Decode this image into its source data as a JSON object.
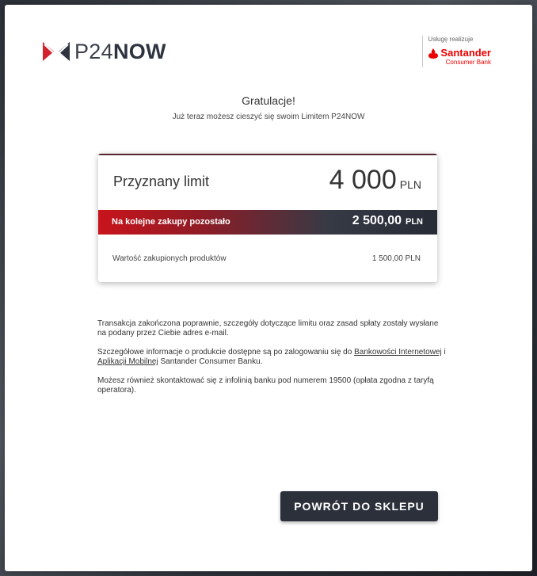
{
  "brand": {
    "logo_light": "P24",
    "logo_bold": "NOW",
    "partner_caption": "Usługę realizuje",
    "partner_name": "Santander",
    "partner_sub": "Consumer Bank"
  },
  "header": {
    "title": "Gratulacje!",
    "subtitle": "Już teraz możesz cieszyć się swoim Limitem P24NOW"
  },
  "limit_card": {
    "granted_label": "Przyznany limit",
    "granted_amount": "4 000",
    "granted_currency": "PLN",
    "remaining_label": "Na kolejne zakupy pozostało",
    "remaining_amount": "2 500,00",
    "remaining_currency": "PLN",
    "purchased_label": "Wartość zakupionych produktów",
    "purchased_amount": "1 500,00 PLN"
  },
  "info": {
    "p1": "Transakcja zakończona poprawnie, szczegóły dotyczące limitu oraz zasad spłaty zostały wysłane na podany przez Ciebie adres e-mail.",
    "p2_before": "Szczegółowe informacje o produkcie dostępne są po zalogowaniu się do ",
    "p2_link1": "Bankowości Internetowej",
    "p2_mid": " i ",
    "p2_link2": "Aplikacji Mobilnej",
    "p2_after": " Santander Consumer Banku.",
    "p3": "Możesz również skontaktować się z infolinią banku pod numerem 19500 (opłata zgodna z taryfą operatora)."
  },
  "actions": {
    "back_label": "POWRÓT DO SKLEPU"
  },
  "colors": {
    "accent_red": "#c9141c",
    "dark": "#2b303b",
    "santander_red": "#ec0000"
  }
}
